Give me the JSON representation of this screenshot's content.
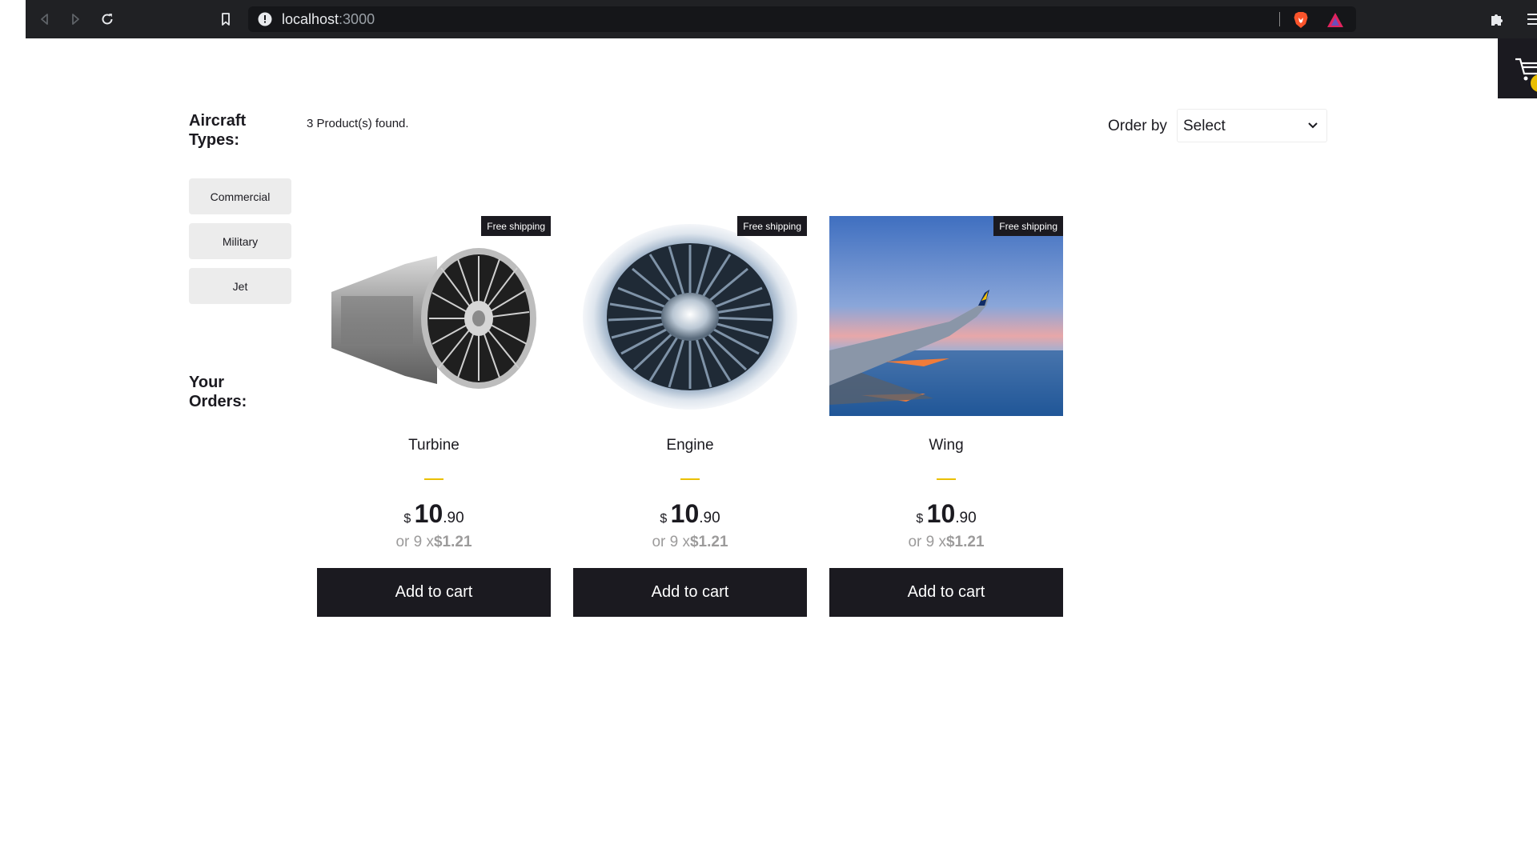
{
  "browser": {
    "url_host": "localhost",
    "url_port": ":3000"
  },
  "sidebar": {
    "aircraft_types_title": "Aircraft Types:",
    "filters": [
      {
        "label": "Commercial"
      },
      {
        "label": "Military"
      },
      {
        "label": "Jet"
      }
    ],
    "orders_title": "Your Orders:"
  },
  "shelf": {
    "products_found": "3 Product(s) found.",
    "order_by_label": "Order by",
    "order_by_selected": "Select"
  },
  "products": [
    {
      "title": "Turbine",
      "badge": "Free shipping",
      "currency": "$",
      "price_int": "10",
      "price_dec": ".90",
      "installments_prefix": "or 9 x",
      "installment_value": "$1.21",
      "button": "Add to cart",
      "image_icon": "turbine-image"
    },
    {
      "title": "Engine",
      "badge": "Free shipping",
      "currency": "$",
      "price_int": "10",
      "price_dec": ".90",
      "installments_prefix": "or 9 x",
      "installment_value": "$1.21",
      "button": "Add to cart",
      "image_icon": "engine-image"
    },
    {
      "title": "Wing",
      "badge": "Free shipping",
      "currency": "$",
      "price_int": "10",
      "price_dec": ".90",
      "installments_prefix": "or 9 x",
      "installment_value": "$1.21",
      "button": "Add to cart",
      "image_icon": "wing-image"
    }
  ],
  "colors": {
    "primary_dark": "#1b1a20",
    "accent": "#eabf00",
    "muted": "#9c9b9b",
    "filter_bg": "#ececec"
  }
}
